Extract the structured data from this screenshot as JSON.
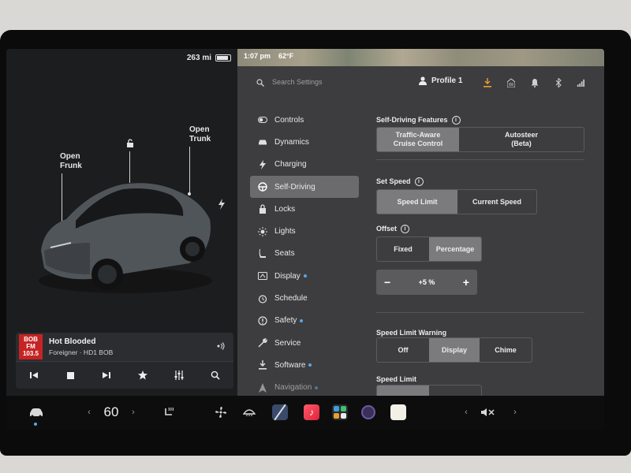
{
  "vehicle": {
    "range": "263 mi",
    "open_frunk": "Open\nFrunk",
    "open_trunk": "Open\nTrunk"
  },
  "media": {
    "station_logo": "BOB FM 103.5",
    "title": "Hot Blooded",
    "subtitle": "Foreigner · HD1 BOB"
  },
  "status": {
    "time": "1:07 pm",
    "temp": "62°F"
  },
  "header": {
    "search_placeholder": "Search Settings",
    "profile": "Profile 1"
  },
  "nav": [
    {
      "label": "Controls",
      "icon": "toggle-icon",
      "dot": false
    },
    {
      "label": "Dynamics",
      "icon": "car-icon",
      "dot": false
    },
    {
      "label": "Charging",
      "icon": "bolt-icon",
      "dot": false
    },
    {
      "label": "Self-Driving",
      "icon": "steering-wheel-icon",
      "dot": false,
      "active": true
    },
    {
      "label": "Locks",
      "icon": "lock-icon",
      "dot": false
    },
    {
      "label": "Lights",
      "icon": "sun-icon",
      "dot": false
    },
    {
      "label": "Seats",
      "icon": "seat-icon",
      "dot": false
    },
    {
      "label": "Display",
      "icon": "display-icon",
      "dot": true
    },
    {
      "label": "Schedule",
      "icon": "alarm-icon",
      "dot": false
    },
    {
      "label": "Safety",
      "icon": "alert-icon",
      "dot": true
    },
    {
      "label": "Service",
      "icon": "wrench-icon",
      "dot": false
    },
    {
      "label": "Software",
      "icon": "download-icon",
      "dot": true
    },
    {
      "label": "Navigation",
      "icon": "navigation-icon",
      "dot": true
    }
  ],
  "panel": {
    "features_label": "Self-Driving Features",
    "features": [
      "Traffic-Aware\nCruise Control",
      "Autosteer\n(Beta)"
    ],
    "set_speed_label": "Set Speed",
    "set_speed": [
      "Speed Limit",
      "Current Speed"
    ],
    "offset_label": "Offset",
    "offset": [
      "Fixed",
      "Percentage"
    ],
    "offset_value": "+5 %",
    "minus": "−",
    "plus": "+",
    "warning_label": "Speed Limit Warning",
    "warning": [
      "Off",
      "Display",
      "Chime"
    ],
    "speed_limit_label": "Speed Limit"
  },
  "dock": {
    "temperature": "60",
    "chev_left": "‹",
    "chev_right": "›"
  },
  "colors": {
    "selected": "#7b7b7d",
    "accent_dot": "#5aa6e8",
    "download": "#e8a030"
  }
}
